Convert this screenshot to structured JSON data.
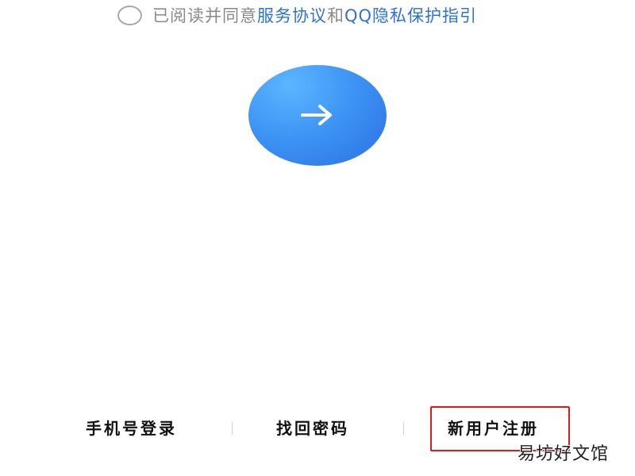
{
  "agreement": {
    "prefix": "已阅读并同意",
    "terms_link": "服务协议",
    "conjunction": "和",
    "privacy_link": "QQ隐私保护指引"
  },
  "next_button": {
    "icon": "arrow-right-icon"
  },
  "footer": {
    "phone_login": "手机号登录",
    "recover_password": "找回密码",
    "register": "新用户注册"
  },
  "watermark": "易坊好文馆",
  "colors": {
    "link": "#2f72d6",
    "button_gradient_start": "#5cb6ff",
    "button_gradient_end": "#2a6fe4",
    "highlight_box": "#e01a1a"
  }
}
